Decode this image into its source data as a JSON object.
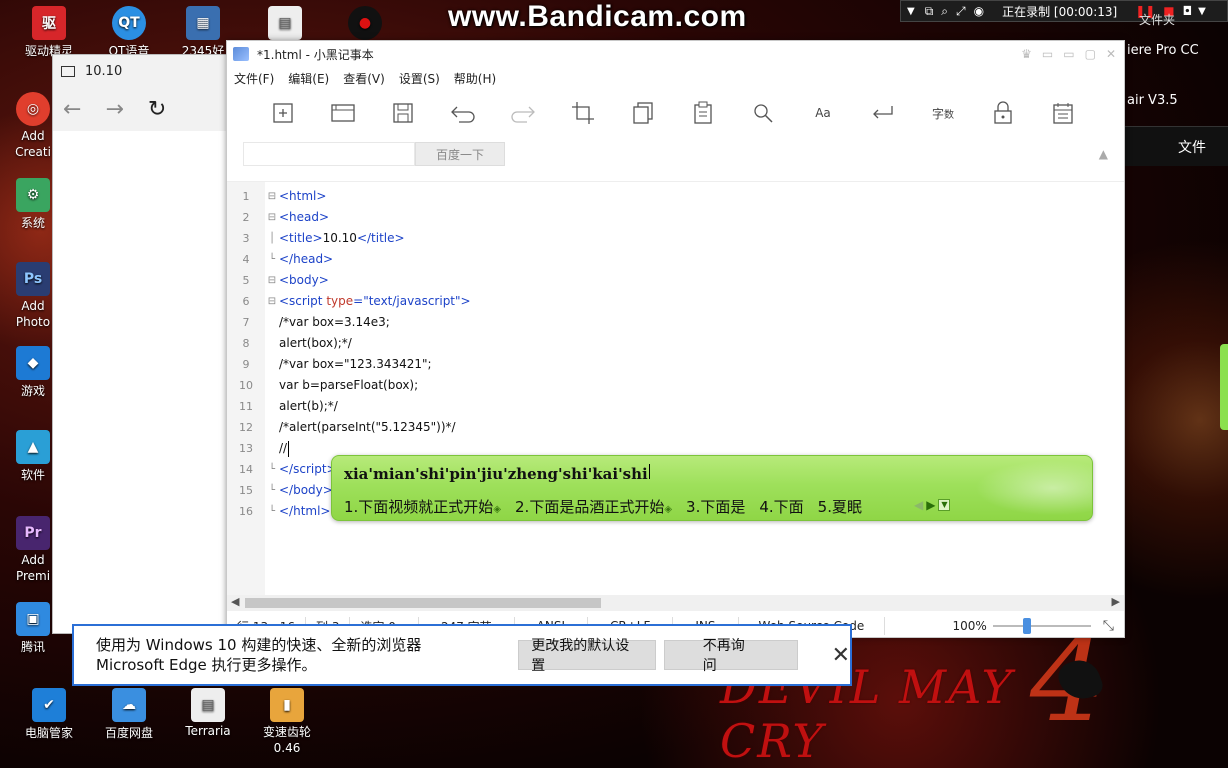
{
  "watermark": "www.Bandicam.com",
  "recording": {
    "status": "正在录制 [00:00:13]",
    "right_fragment": "文件夹"
  },
  "desktop_icons": [
    {
      "label": "驱动精灵",
      "glyph": "驱",
      "color": "#d7262a"
    },
    {
      "label": "QT语音",
      "glyph": "QT",
      "color": "#2b8fe3"
    },
    {
      "label": "2345好",
      "glyph": "▦",
      "color": "#3a6fb0"
    },
    {
      "label": "",
      "glyph": "▤",
      "color": "#eeeeee"
    },
    {
      "label": "",
      "glyph": "●",
      "color": "#d11"
    },
    {
      "label": "Add Creati",
      "glyph": "◎",
      "color": "#e03e2d"
    },
    {
      "label": "系统",
      "glyph": "⚙",
      "color": "#3aa560"
    },
    {
      "label": "Add Photo",
      "glyph": "Ps",
      "color": "#2a3d72"
    },
    {
      "label": "游戏",
      "glyph": "◆",
      "color": "#1d7ad4"
    },
    {
      "label": "软件",
      "glyph": "▲",
      "color": "#2a9fd6"
    },
    {
      "label": "Add Premi",
      "glyph": "Pr",
      "color": "#48256e"
    },
    {
      "label": "腾讯",
      "glyph": "▣",
      "color": "#2f8ae0"
    },
    {
      "label": "电脑管家",
      "glyph": "✔",
      "color": "#1e7fd8"
    },
    {
      "label": "百度网盘",
      "glyph": "☁",
      "color": "#3a8fe0"
    },
    {
      "label": "Terraria",
      "glyph": "▤",
      "color": "#eeeeee"
    },
    {
      "label": "变速齿轮 0.46",
      "glyph": "▮",
      "color": "#e8a53c"
    }
  ],
  "right_fragments": {
    "premiere": "iere Pro CC",
    "air": "air V3.5",
    "file": "文件"
  },
  "edge": {
    "tab_title": "10.10",
    "notification": {
      "message": "使用为 Windows 10 构建的快速、全新的浏览器 Microsoft Edge 执行更多操作。",
      "change_default": "更改我的默认设置",
      "dont_ask": "不再询问"
    }
  },
  "notepad": {
    "title": "*1.html - 小黑记事本",
    "menu": [
      "文件(F)",
      "编辑(E)",
      "查看(V)",
      "设置(S)",
      "帮助(H)"
    ],
    "toolbar_icons": [
      "new-icon",
      "open-icon",
      "save-icon",
      "undo-icon",
      "redo-icon",
      "crop-icon",
      "copy-icon",
      "paste-icon",
      "find-icon",
      "replace-icon",
      "wrap-icon",
      "word-count-icon",
      "lock-icon",
      "calendar-icon"
    ],
    "search_button": "百度一下",
    "code_lines": [
      {
        "num": "1"
      },
      {
        "num": "2"
      },
      {
        "num": "3"
      },
      {
        "num": "4"
      },
      {
        "num": "5"
      },
      {
        "num": "6"
      },
      {
        "num": "7",
        "text": "/*var box=3.14e3;"
      },
      {
        "num": "8",
        "text": "alert(box);*/"
      },
      {
        "num": "9",
        "text": "/*var box=\"123.343421\";"
      },
      {
        "num": "10",
        "text": "var b=parseFloat(box);"
      },
      {
        "num": "11",
        "text": "alert(b);*/"
      },
      {
        "num": "12",
        "text": "/*alert(parseInt(\"5.12345\"))*/"
      },
      {
        "num": "13",
        "text": "//"
      },
      {
        "num": "14"
      },
      {
        "num": "15"
      },
      {
        "num": "16"
      }
    ],
    "line3_text": "10.10",
    "line6_attr": "type",
    "line6_value": "\"text/javascript\"",
    "status": {
      "position": "行 13 : 16",
      "column": "列 3",
      "selection": "选定 0",
      "bytes": "247 字节",
      "encoding": "ANSI",
      "line_ending": "CR+LF",
      "mode": "INS",
      "language": "Web Source Code",
      "zoom": "100%",
      "zoom_level": 0.35
    }
  },
  "ime": {
    "pinyin": "xia'mian'shi'pin'jiu'zheng'shi'kai'shi",
    "candidates": [
      "1.下面视频就正式开始",
      "2.下面是品酒正式开始",
      "3.下面是",
      "4.下面",
      "5.夏眠"
    ]
  }
}
